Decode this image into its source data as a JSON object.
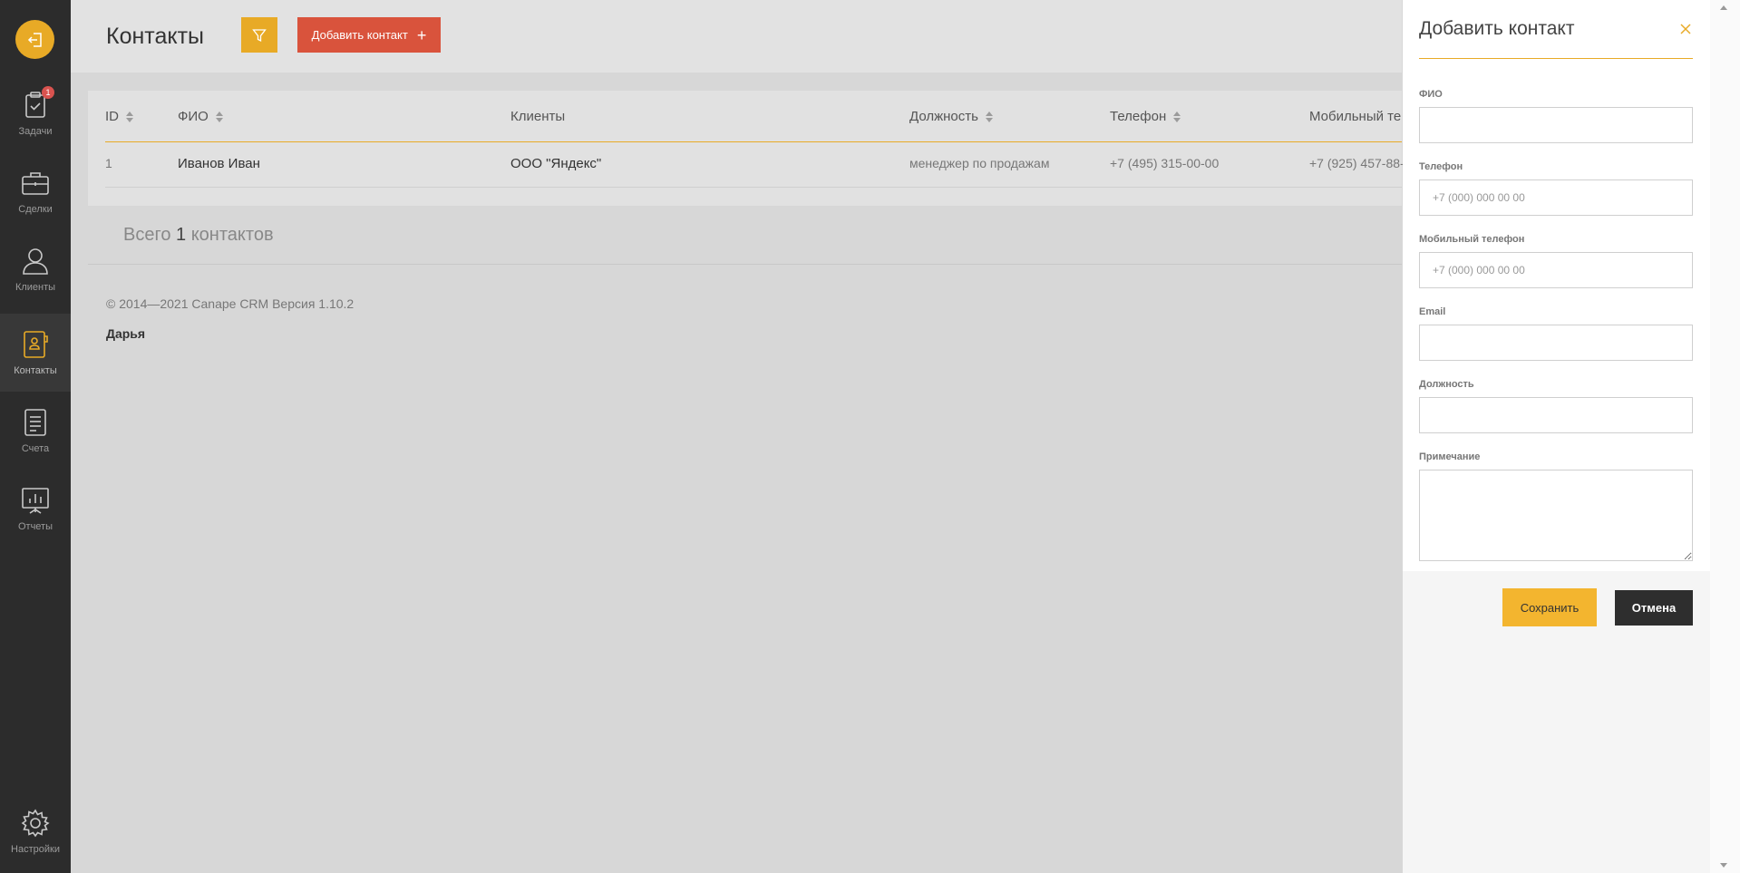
{
  "sidebar": {
    "logout_icon": "logout-icon",
    "items": [
      {
        "label": "Задачи",
        "icon": "clipboard-check-icon",
        "badge": "1"
      },
      {
        "label": "Сделки",
        "icon": "briefcase-icon"
      },
      {
        "label": "Клиенты",
        "icon": "user-icon"
      },
      {
        "label": "Контакты",
        "icon": "contact-book-icon",
        "active": true
      },
      {
        "label": "Счета",
        "icon": "invoice-icon"
      },
      {
        "label": "Отчеты",
        "icon": "chart-board-icon"
      }
    ],
    "settings_label": "Настройки"
  },
  "header": {
    "title": "Контакты",
    "add_label": "Добавить контакт",
    "add_icon": "+"
  },
  "table": {
    "columns": [
      "ID",
      "ФИО",
      "Клиенты",
      "Должность",
      "Телефон",
      "Мобильный те"
    ],
    "rows": [
      {
        "id": "1",
        "name": "Иванов Иван",
        "client": "ООО \"Яндекс\"",
        "position": "менеджер по продажам",
        "phone": "+7 (495) 315-00-00",
        "mobile": "+7 (925) 457-88-"
      }
    ],
    "total_prefix": "Всего",
    "total_count": "1",
    "total_suffix": "контактов"
  },
  "footer": {
    "copyright": "© 2014—2021 Canape CRM Версия 1.10.2",
    "user": "Дарья"
  },
  "panel": {
    "title": "Добавить контакт",
    "fields": {
      "fio_label": "ФИО",
      "phone_label": "Телефон",
      "phone_placeholder": "+7 (000) 000 00 00",
      "mobile_label": "Мобильный телефон",
      "mobile_placeholder": "+7 (000) 000 00 00",
      "email_label": "Email",
      "position_label": "Должность",
      "note_label": "Примечание"
    },
    "save_label": "Сохранить",
    "cancel_label": "Отмена"
  },
  "colors": {
    "accent": "#e8aa26",
    "danger": "#d9533c",
    "sidebar": "#2c2c2c"
  }
}
